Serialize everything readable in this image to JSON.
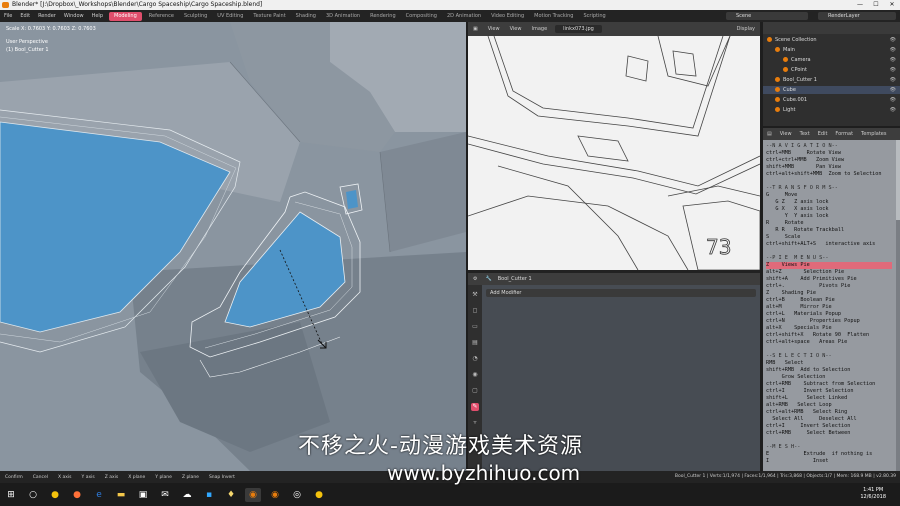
{
  "window": {
    "title": "Blender* [J:\\Dropbox\\_Workshops\\Blender\\Cargo Spaceship\\Cargo Spaceship.blend]",
    "controls": [
      "—",
      "☐",
      "✕"
    ]
  },
  "topbar": {
    "menu": [
      "File",
      "Edit",
      "Render",
      "Window",
      "Help"
    ],
    "workspaces": [
      "Modeling",
      "Reference",
      "Sculpting",
      "UV Editing",
      "Texture Paint",
      "Shading",
      "3D Animation",
      "Rendering",
      "Compositing",
      "2D Animation",
      "Video Editing",
      "Motion Tracking",
      "Scripting"
    ],
    "active_workspace": "Modeling",
    "scene": "Scene",
    "render_layer": "RenderLayer"
  },
  "viewport": {
    "scale_readout": "Scale X: 0.7603  Y: 0.7603  Z: 0.7603",
    "view_label": "User Perspective",
    "object_label": "(1) Bool_Cutter 1"
  },
  "image_editor": {
    "header": [
      "View",
      "View",
      "Image"
    ],
    "image_name": "linkx073.jpg",
    "display": "Display",
    "sketch_number": "73"
  },
  "properties": {
    "object_name": "Bool_Cutter 1",
    "add_modifier": "Add Modifier"
  },
  "outliner": {
    "rows": [
      {
        "label": "Scene Collection",
        "indent": 0,
        "selected": false
      },
      {
        "label": "Main",
        "indent": 1,
        "selected": false
      },
      {
        "label": "Camera",
        "indent": 2,
        "selected": false
      },
      {
        "label": "CPoint",
        "indent": 2,
        "selected": false
      },
      {
        "label": "Bool_Cutter 1",
        "indent": 1,
        "selected": false
      },
      {
        "label": "Cube",
        "indent": 1,
        "selected": true
      },
      {
        "label": "Cube.001",
        "indent": 1,
        "selected": false
      },
      {
        "label": "Light",
        "indent": 1,
        "selected": false
      }
    ]
  },
  "text_editor": {
    "header": [
      "View",
      "Text",
      "Edit",
      "Format",
      "Templates"
    ],
    "lines": [
      {
        "t": "--N A V I G A T I O N--",
        "h": true
      },
      {
        "t": "ctrl+MMB     Rotate View"
      },
      {
        "t": "ctrl+ctrl+MMB   Zoom View"
      },
      {
        "t": "shift+MMB       Pan View"
      },
      {
        "t": "ctrl+alt+shift+MMB  Zoom to Selection"
      },
      {
        "t": ""
      },
      {
        "t": "--T R A N S F O R M S--",
        "h": true
      },
      {
        "t": "G     Move"
      },
      {
        "t": "   G Z   Z axis lock"
      },
      {
        "t": "   G X   X axis lock"
      },
      {
        "t": "      Y  Y axis lock"
      },
      {
        "t": "R     Rotate"
      },
      {
        "t": "   R R   Rotate Trackball"
      },
      {
        "t": "S     Scale"
      },
      {
        "t": "ctrl+shift+ALT+S   interactive axis"
      },
      {
        "t": ""
      },
      {
        "t": "--P I E  M E N U S--",
        "h": true
      },
      {
        "t": "Z    Views Pie",
        "hl": true
      },
      {
        "t": "alt+Z       Selection Pie"
      },
      {
        "t": "shift+A    Add Primitives Pie"
      },
      {
        "t": "ctrl+.           Pivots Pie"
      },
      {
        "t": "Z    Shading Pie"
      },
      {
        "t": "ctrl+B     Boolean Pie"
      },
      {
        "t": "alt+M      Mirror Pie"
      },
      {
        "t": "ctrl+L   Materials Popup"
      },
      {
        "t": "ctrl+N        Properties Popup"
      },
      {
        "t": "alt+X    Specials Pie"
      },
      {
        "t": "ctrl+shift+X   Rotate 90  Flatten"
      },
      {
        "t": "ctrl+alt+space   Areas Pie"
      },
      {
        "t": ""
      },
      {
        "t": "--S E L E C T I O N--",
        "h": true
      },
      {
        "t": "RMB   Select"
      },
      {
        "t": "shift+RMB  Add to Selection"
      },
      {
        "t": "     Grow Selection"
      },
      {
        "t": "ctrl+RMB    Subtract from Selection"
      },
      {
        "t": "ctrl+I      Invert Selection"
      },
      {
        "t": "shift+L      Select Linked"
      },
      {
        "t": "alt+RMB   Select Loop"
      },
      {
        "t": "ctrl+alt+RMB   Select Ring"
      },
      {
        "t": "  Select All     Deselect All"
      },
      {
        "t": "ctrl+I     Invert Selection"
      },
      {
        "t": "ctrl+RMB     Select Between"
      },
      {
        "t": ""
      },
      {
        "t": "--M E S H--",
        "h": true
      },
      {
        "t": "E           Extrude  if nothing is"
      },
      {
        "t": "I              Inset"
      }
    ]
  },
  "statusbar": {
    "items": [
      "Confirm",
      "Cancel",
      "X axis",
      "Y axis",
      "Z axis",
      "X plane",
      "Y plane",
      "Z plane",
      "Snap Invert"
    ],
    "right": "Bool_Cutter 1 | Verts:1/1,974 | Faces:1/1,964 | Tris:3,868 | Objects:1/7 | Mem: 168.9 MB | v2.80.39"
  },
  "taskbar": {
    "icons": [
      "windows-icon",
      "search-icon",
      "chrome-icon",
      "firefox-icon",
      "explorer-icon",
      "folder-icon",
      "store-icon",
      "mail-icon",
      "cloud-icon",
      "photoshop-icon",
      "bulb-icon",
      "blender-icon",
      "blender-icon-2",
      "record-icon",
      "chrome-icon-2"
    ],
    "time": "1:41 PM",
    "date": "12/6/2018"
  },
  "watermark": {
    "line1": "不移之火-动漫游戏美术资源",
    "line2": "www.byzhihuo.com"
  },
  "colors": {
    "accent": "#e04e6c",
    "blender_orange": "#e87d0d",
    "boolean_blue": "#4d94c8"
  }
}
